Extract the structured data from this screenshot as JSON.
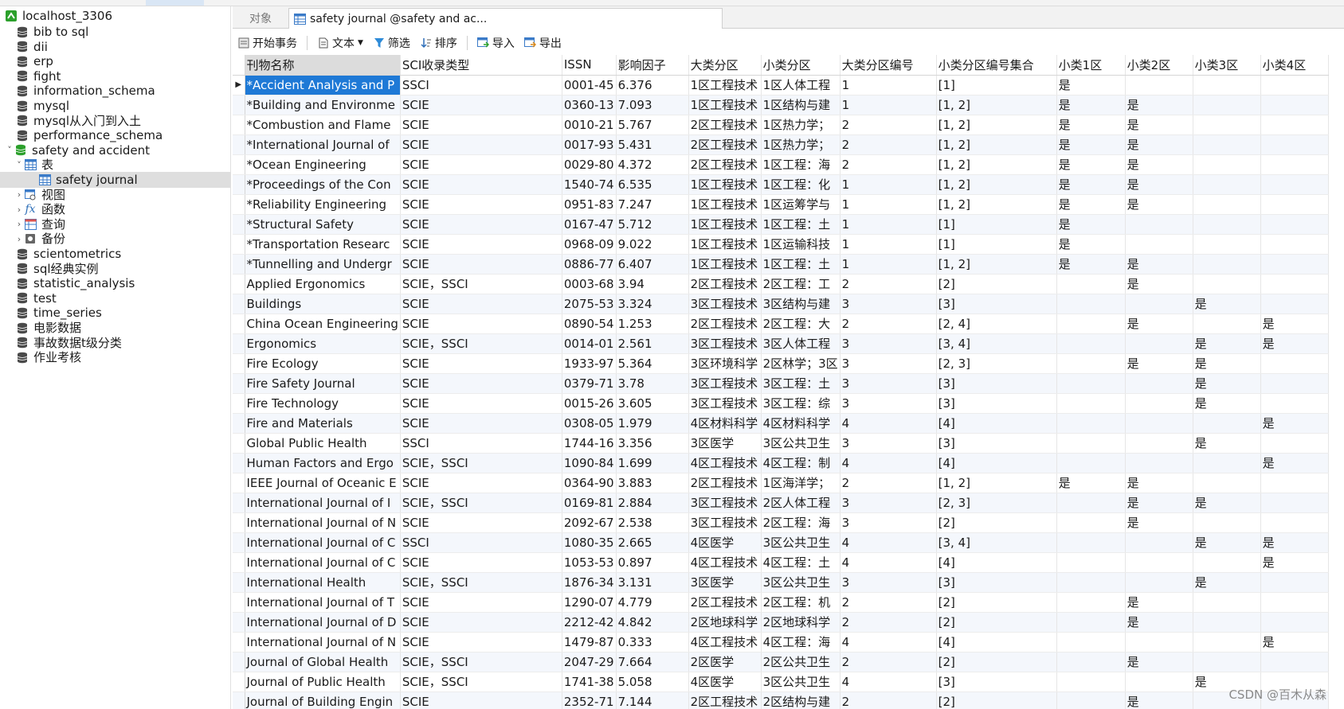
{
  "colors": {
    "selection": "#1e79d6",
    "db_icon": "#4a4a4a",
    "db_icon_open": "#2ca02c",
    "table_icon": "#3b7bc8"
  },
  "sidebar": {
    "connection": {
      "label": "localhost_3306",
      "icon": "connection-icon"
    },
    "databases": [
      {
        "label": "bib to sql"
      },
      {
        "label": "dii"
      },
      {
        "label": "erp"
      },
      {
        "label": "fight"
      },
      {
        "label": "information_schema"
      },
      {
        "label": "mysql"
      },
      {
        "label": "mysql从入门到入土"
      },
      {
        "label": "performance_schema"
      },
      {
        "label": "safety and accident"
      },
      {
        "label": "表"
      },
      {
        "label": "safety journal"
      },
      {
        "label": "视图"
      },
      {
        "label": "函数"
      },
      {
        "label": "查询"
      },
      {
        "label": "备份"
      },
      {
        "label": "scientometrics"
      },
      {
        "label": "sql经典实例"
      },
      {
        "label": "statistic_analysis"
      },
      {
        "label": "test"
      },
      {
        "label": "time_series"
      },
      {
        "label": "电影数据"
      },
      {
        "label": "事故数据t级分类"
      },
      {
        "label": "作业考核"
      }
    ]
  },
  "tabs": {
    "objects": "对象",
    "active": "safety journal @safety and ac..."
  },
  "toolbar": {
    "begin_transaction": "开始事务",
    "text": "文本",
    "filter": "筛选",
    "sort": "排序",
    "import": "导入",
    "export": "导出"
  },
  "grid": {
    "columns": [
      "刊物名称",
      "SCI收录类型",
      "ISSN",
      "影响因子",
      "大类分区",
      "小类分区",
      "大类分区编号",
      "小类分区编号集合",
      "小类1区",
      "小类2区",
      "小类3区",
      "小类4区"
    ],
    "rows": [
      [
        "*Accident Analysis and P",
        "SSCI",
        "0001-45",
        "6.376",
        "1区工程技术",
        "1区人体工程",
        "1",
        "[1]",
        "是",
        "",
        "",
        ""
      ],
      [
        "*Building and Environme",
        "SCIE",
        "0360-13",
        "7.093",
        "1区工程技术",
        "1区结构与建",
        "1",
        "[1, 2]",
        "是",
        "是",
        "",
        ""
      ],
      [
        "*Combustion and Flame",
        "SCIE",
        "0010-21",
        "5.767",
        "2区工程技术",
        "1区热力学；",
        "2",
        "[1, 2]",
        "是",
        "是",
        "",
        ""
      ],
      [
        "*International Journal of",
        "SCIE",
        "0017-93",
        "5.431",
        "2区工程技术",
        "1区热力学；",
        "2",
        "[1, 2]",
        "是",
        "是",
        "",
        ""
      ],
      [
        "*Ocean Engineering",
        "SCIE",
        "0029-80",
        "4.372",
        "2区工程技术",
        "1区工程：海",
        "2",
        "[1, 2]",
        "是",
        "是",
        "",
        ""
      ],
      [
        "*Proceedings of the Con",
        "SCIE",
        "1540-74",
        "6.535",
        "1区工程技术",
        "1区工程：化",
        "1",
        "[1, 2]",
        "是",
        "是",
        "",
        ""
      ],
      [
        "*Reliability Engineering",
        "SCIE",
        "0951-83",
        "7.247",
        "1区工程技术",
        "1区运筹学与",
        "1",
        "[1, 2]",
        "是",
        "是",
        "",
        ""
      ],
      [
        "*Structural Safety",
        "SCIE",
        "0167-47",
        "5.712",
        "1区工程技术",
        "1区工程：土",
        "1",
        "[1]",
        "是",
        "",
        "",
        ""
      ],
      [
        "*Transportation Researc",
        "SCIE",
        "0968-09",
        "9.022",
        "1区工程技术",
        "1区运输科技",
        "1",
        "[1]",
        "是",
        "",
        "",
        ""
      ],
      [
        "*Tunnelling and Undergr",
        "SCIE",
        "0886-77",
        "6.407",
        "1区工程技术",
        "1区工程：土",
        "1",
        "[1, 2]",
        "是",
        "是",
        "",
        ""
      ],
      [
        "Applied Ergonomics",
        "SCIE，SSCI",
        "0003-68",
        "3.94",
        "2区工程技术",
        "2区工程：工",
        "2",
        "[2]",
        "",
        "是",
        "",
        ""
      ],
      [
        "Buildings",
        "SCIE",
        "2075-53",
        "3.324",
        "3区工程技术",
        "3区结构与建",
        "3",
        "[3]",
        "",
        "",
        "是",
        ""
      ],
      [
        "China Ocean Engineering",
        "SCIE",
        "0890-54",
        "1.253",
        "2区工程技术",
        "2区工程：大",
        "2",
        "[2, 4]",
        "",
        "是",
        "",
        "是"
      ],
      [
        "Ergonomics",
        "SCIE，SSCI",
        "0014-01",
        "2.561",
        "3区工程技术",
        "3区人体工程",
        "3",
        "[3, 4]",
        "",
        "",
        "是",
        "是"
      ],
      [
        "Fire Ecology",
        "SCIE",
        "1933-97",
        "5.364",
        "3区环境科学",
        "2区林学；3区",
        "3",
        "[2, 3]",
        "",
        "是",
        "是",
        ""
      ],
      [
        "Fire Safety Journal",
        "SCIE",
        "0379-71",
        "3.78",
        "3区工程技术",
        "3区工程：土",
        "3",
        "[3]",
        "",
        "",
        "是",
        ""
      ],
      [
        "Fire Technology",
        "SCIE",
        "0015-26",
        "3.605",
        "3区工程技术",
        "3区工程：综",
        "3",
        "[3]",
        "",
        "",
        "是",
        ""
      ],
      [
        "Fire and Materials",
        "SCIE",
        "0308-05",
        "1.979",
        "4区材料科学",
        "4区材料科学",
        "4",
        "[4]",
        "",
        "",
        "",
        "是"
      ],
      [
        "Global Public Health",
        "SSCI",
        "1744-16",
        "3.356",
        "3区医学",
        "3区公共卫生",
        "3",
        "[3]",
        "",
        "",
        "是",
        ""
      ],
      [
        "Human Factors and Ergo",
        "SCIE，SSCI",
        "1090-84",
        "1.699",
        "4区工程技术",
        "4区工程：制",
        "4",
        "[4]",
        "",
        "",
        "",
        "是"
      ],
      [
        "IEEE Journal of Oceanic E",
        "SCIE",
        "0364-90",
        "3.883",
        "2区工程技术",
        "1区海洋学；",
        "2",
        "[1, 2]",
        "是",
        "是",
        "",
        ""
      ],
      [
        "International Journal of I",
        "SCIE，SSCI",
        "0169-81",
        "2.884",
        "3区工程技术",
        "2区人体工程",
        "3",
        "[2, 3]",
        "",
        "是",
        "是",
        ""
      ],
      [
        "International Journal of N",
        "SCIE",
        "2092-67",
        "2.538",
        "3区工程技术",
        "2区工程：海",
        "3",
        "[2]",
        "",
        "是",
        "",
        ""
      ],
      [
        "International Journal of C",
        "SSCI",
        "1080-35",
        "2.665",
        "4区医学",
        "3区公共卫生",
        "4",
        "[3, 4]",
        "",
        "",
        "是",
        "是"
      ],
      [
        "International Journal of C",
        "SCIE",
        "1053-53",
        "0.897",
        "4区工程技术",
        "4区工程：土",
        "4",
        "[4]",
        "",
        "",
        "",
        "是"
      ],
      [
        "International Health",
        "SCIE，SSCI",
        "1876-34",
        "3.131",
        "3区医学",
        "3区公共卫生",
        "3",
        "[3]",
        "",
        "",
        "是",
        ""
      ],
      [
        "International Journal of T",
        "SCIE",
        "1290-07",
        "4.779",
        "2区工程技术",
        "2区工程：机",
        "2",
        "[2]",
        "",
        "是",
        "",
        ""
      ],
      [
        "International Journal of D",
        "SCIE",
        "2212-42",
        "4.842",
        "2区地球科学",
        "2区地球科学",
        "2",
        "[2]",
        "",
        "是",
        "",
        ""
      ],
      [
        "International Journal of N",
        "SCIE",
        "1479-87",
        "0.333",
        "4区工程技术",
        "4区工程：海",
        "4",
        "[4]",
        "",
        "",
        "",
        "是"
      ],
      [
        "Journal of Global Health",
        "SCIE，SSCI",
        "2047-29",
        "7.664",
        "2区医学",
        "2区公共卫生",
        "2",
        "[2]",
        "",
        "是",
        "",
        ""
      ],
      [
        "Journal of Public Health",
        "SCIE，SSCI",
        "1741-38",
        "5.058",
        "4区医学",
        "3区公共卫生",
        "4",
        "[3]",
        "",
        "",
        "是",
        ""
      ],
      [
        "Journal of Building Engin",
        "SCIE",
        "2352-71",
        "7.144",
        "2区工程技术",
        "2区结构与建",
        "2",
        "[2]",
        "",
        "是",
        "",
        ""
      ]
    ]
  },
  "watermark": "CSDN @百木从森"
}
